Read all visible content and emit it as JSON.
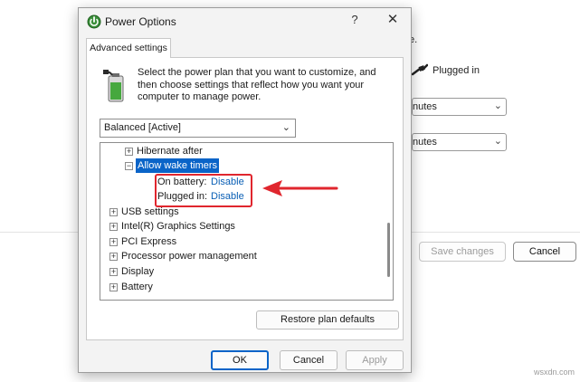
{
  "background_window": {
    "hint_text": "e.",
    "plugged_in_label": "Plugged in",
    "select_1_value": "nutes",
    "select_2_value": "nutes",
    "save_changes_label": "Save changes",
    "cancel_label": "Cancel"
  },
  "dialog": {
    "title": "Power Options",
    "help_glyph": "?",
    "close_glyph": "✕",
    "tab_label": "Advanced settings",
    "description": "Select the power plan that you want to customize, and then choose settings that reflect how you want your computer to manage power.",
    "plan_select": {
      "value": "Balanced [Active]"
    },
    "tree": {
      "items": [
        {
          "label": "Hibernate after",
          "expander": "+"
        },
        {
          "label": "Allow wake timers",
          "expander": "−",
          "selected": true
        },
        {
          "label": "USB settings",
          "expander": "+"
        },
        {
          "label": "Intel(R) Graphics Settings",
          "expander": "+"
        },
        {
          "label": "PCI Express",
          "expander": "+"
        },
        {
          "label": "Processor power management",
          "expander": "+"
        },
        {
          "label": "Display",
          "expander": "+"
        },
        {
          "label": "Battery",
          "expander": "+"
        }
      ],
      "sub_settings": [
        {
          "label": "On battery:",
          "value": "Disable"
        },
        {
          "label": "Plugged in:",
          "value": "Disable"
        }
      ]
    },
    "restore_label": "Restore plan defaults",
    "ok_label": "OK",
    "cancel_label": "Cancel",
    "apply_label": "Apply"
  },
  "icons": {
    "title": "power-options-icon",
    "battery": "battery-plug-icon",
    "arrow": "red-arrow-annotation",
    "plug": "plug-icon"
  },
  "colors": {
    "accent": "#0a64c8",
    "annotation_red": "#e0262e",
    "link": "#0a5fb5"
  },
  "watermark": "wsxdn.com"
}
